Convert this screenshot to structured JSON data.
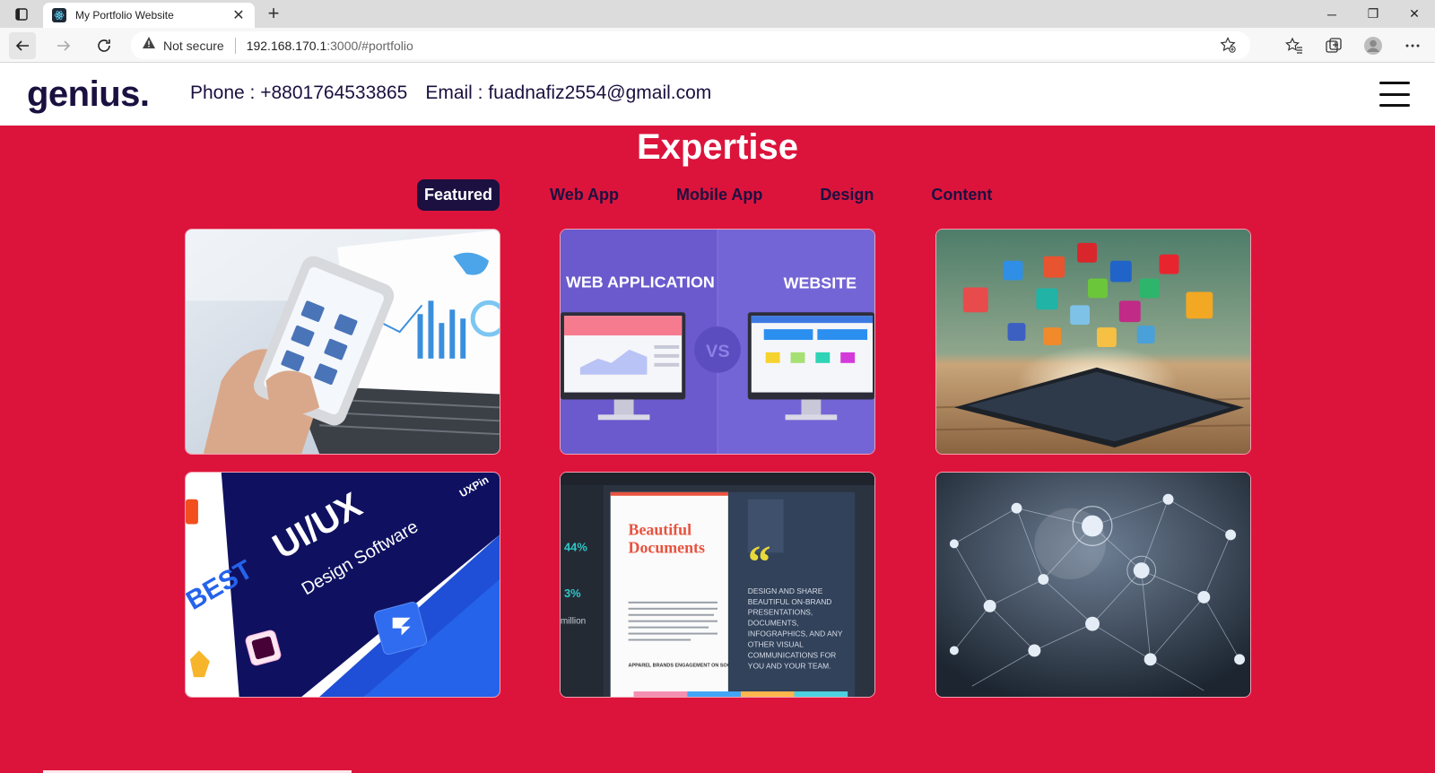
{
  "browser": {
    "tab_title": "My Portfolio Website",
    "security_text": "Not secure",
    "url_host": "192.168.170.1",
    "url_path": ":3000/#portfolio"
  },
  "header": {
    "logo": "genius.",
    "phone": "Phone : +8801764533865",
    "email": "Email : fuadnafiz2554@gmail.com"
  },
  "section": {
    "title": "Expertise",
    "filters": [
      "Featured",
      "Web App",
      "Mobile App",
      "Design",
      "Content"
    ],
    "active_filter": "Featured"
  },
  "cards": {
    "webapp_left": "WEB APPLICATION",
    "webapp_right": "WEBSITE",
    "webapp_vs": "VS",
    "uiux_best": "BEST",
    "uiux_title": "UI/UX",
    "uiux_sub": "Design Software",
    "uiux_badge": "UXPin",
    "doc_title_1": "Beautiful",
    "doc_title_2": "Documents",
    "doc_stat_1": "44%",
    "doc_stat_2": "3%",
    "doc_stat_3": "million",
    "doc_quote_text": "DESIGN AND SHARE BEAUTIFUL ON-BRAND PRESENTATIONS, DOCUMENTS, INFOGRAPHICS, AND ANY OTHER VISUAL COMMUNICATIONS FOR YOU AND YOUR TEAM.",
    "doc_caption": "APPAREL BRANDS ENGAGEMENT ON SOCIAL MEDIA"
  },
  "colors": {
    "brand_red": "#dc143c",
    "navy": "#1b1040"
  }
}
